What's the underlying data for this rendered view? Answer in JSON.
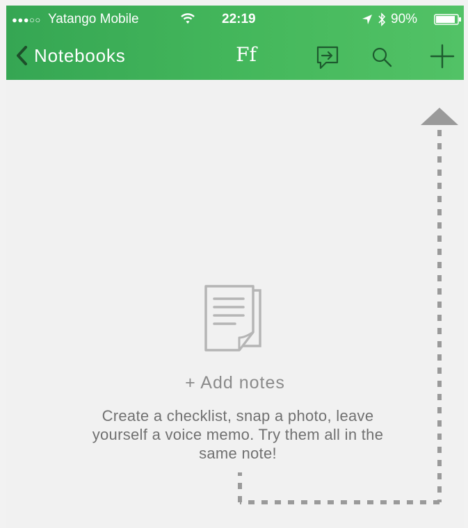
{
  "status_bar": {
    "signal": "●●●○○",
    "carrier": "Yatango Mobile",
    "time": "22:19",
    "battery_percent": "90%",
    "battery_level": 0.9
  },
  "nav": {
    "back_label": "Notebooks",
    "title": "Ff"
  },
  "empty_state": {
    "add_notes_label": "+ Add notes",
    "description": "Create a checklist, snap a photo, leave yourself a voice memo. Try them all in the same note!"
  },
  "colors": {
    "header_green": "#45b85c",
    "guide_gray": "#9a9a9a",
    "icon_gray": "#b5b5b5"
  }
}
